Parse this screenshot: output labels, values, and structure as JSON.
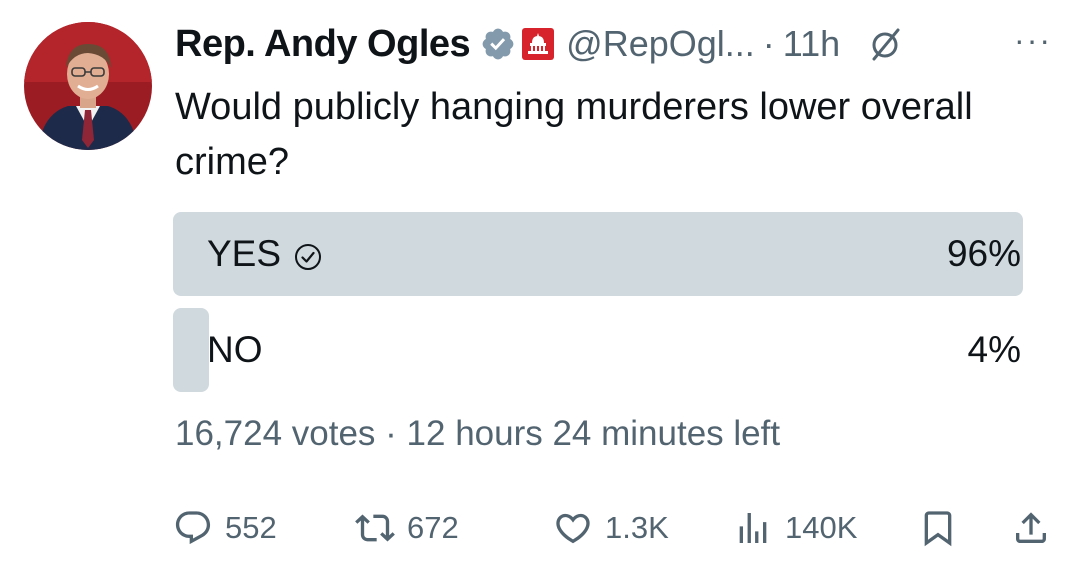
{
  "tweet": {
    "author_name": "Rep. Andy Ogles",
    "handle": "@RepOgl...",
    "separator": "·",
    "time": "11h",
    "more_label": "···",
    "text": "Would publicly hanging murderers lower overall crime?"
  },
  "poll": {
    "options": [
      {
        "label": "YES",
        "percent_label": "96%",
        "percent": 96,
        "selected": true
      },
      {
        "label": "NO",
        "percent_label": "4%",
        "percent": 4,
        "selected": false
      }
    ],
    "meta": "16,724 votes · 12 hours 24 minutes left"
  },
  "actions": {
    "replies": "552",
    "reposts": "672",
    "likes": "1.3K",
    "views": "140K"
  },
  "icons": {
    "verified": "verified-badge-icon",
    "affiliation": "capitol-affiliation-icon",
    "grok": "grok-icon",
    "check": "check-circle-icon",
    "reply": "reply-icon",
    "repost": "repost-icon",
    "like": "heart-icon",
    "views": "views-icon",
    "bookmark": "bookmark-icon",
    "share": "share-icon"
  },
  "colors": {
    "text": "#0f1419",
    "muted": "#536471",
    "poll_fill": "#cfd9de",
    "verified_badge": "#829aab",
    "affiliation_bg": "#d7242c"
  }
}
